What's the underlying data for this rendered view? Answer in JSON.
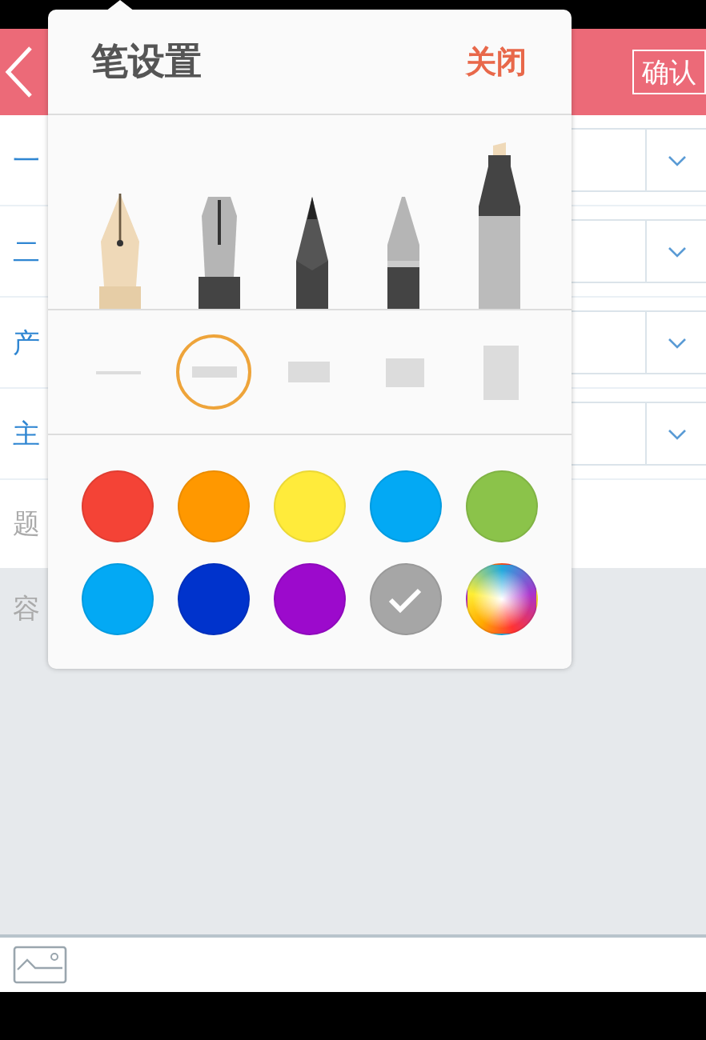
{
  "header": {
    "confirm": "确认"
  },
  "form_rows": [
    {
      "label": "一"
    },
    {
      "label": "二"
    },
    {
      "label": "产"
    },
    {
      "label": "主"
    }
  ],
  "title_field": {
    "placeholder": "题"
  },
  "content_field": {
    "placeholder": "容"
  },
  "pen_settings": {
    "title": "笔设置",
    "close": "关闭",
    "pens": [
      {
        "kind": "fountain"
      },
      {
        "kind": "steel"
      },
      {
        "kind": "pencil"
      },
      {
        "kind": "ballpoint"
      },
      {
        "kind": "marker"
      }
    ],
    "thickness": [
      {
        "selected": false
      },
      {
        "selected": true
      },
      {
        "selected": false
      },
      {
        "selected": false
      },
      {
        "selected": false
      }
    ],
    "colors": [
      {
        "color": "#f44336",
        "selected": false
      },
      {
        "color": "#ff9800",
        "selected": false
      },
      {
        "color": "#ffeb3b",
        "selected": false
      },
      {
        "color": "#03a9f4",
        "selected": false
      },
      {
        "color": "#8bc34a",
        "selected": false
      },
      {
        "color": "#03a9f4",
        "selected": false
      },
      {
        "color": "#0033cc",
        "selected": false
      },
      {
        "color": "#9c0acc",
        "selected": false
      },
      {
        "color": "#a6a6a6",
        "selected": true
      },
      {
        "kind": "wheel",
        "selected": false
      }
    ]
  }
}
